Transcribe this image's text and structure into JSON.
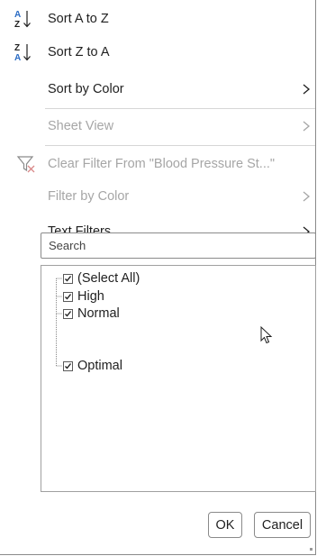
{
  "menu": {
    "sort_az": "Sort A to Z",
    "sort_za": "Sort Z to A",
    "sort_by_color": "Sort by Color",
    "sheet_view": "Sheet View",
    "clear_filter": "Clear Filter From \"Blood Pressure St...\"",
    "filter_by_color": "Filter by Color",
    "text_filters": "Text Filters"
  },
  "search": {
    "placeholder": "Search"
  },
  "filter_list": {
    "items": [
      {
        "label": "(Select All)",
        "checked": true
      },
      {
        "label": "High",
        "checked": true
      },
      {
        "label": "Normal",
        "checked": true
      },
      {
        "label": "Optimal",
        "checked": true
      }
    ]
  },
  "buttons": {
    "ok": "OK",
    "cancel": "Cancel"
  },
  "icons": {
    "sort_az": "sort-ascending-icon",
    "sort_za": "sort-descending-icon",
    "clear_filter": "clear-filter-icon",
    "chevron": "chevron-right-icon",
    "cursor": "mouse-pointer-icon"
  },
  "colors": {
    "sort_accent": "#2b6cc4",
    "disabled_text": "#a6a6a6",
    "clear_filter_x": "#d03030"
  }
}
